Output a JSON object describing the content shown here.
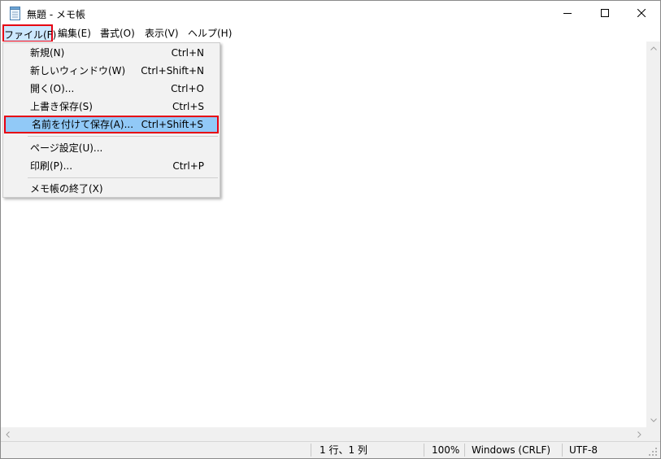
{
  "window": {
    "title": "無題 - メモ帳"
  },
  "menubar": {
    "file": "ファイル(F)",
    "edit": "編集(E)",
    "format": "書式(O)",
    "view": "表示(V)",
    "help": "ヘルプ(H)"
  },
  "file_menu": {
    "items": [
      {
        "label": "新規(N)",
        "shortcut": "Ctrl+N"
      },
      {
        "label": "新しいウィンドウ(W)",
        "shortcut": "Ctrl+Shift+N"
      },
      {
        "label": "開く(O)...",
        "shortcut": "Ctrl+O"
      },
      {
        "label": "上書き保存(S)",
        "shortcut": "Ctrl+S"
      },
      {
        "label": "名前を付けて保存(A)...",
        "shortcut": "Ctrl+Shift+S"
      },
      {
        "label": "ページ設定(U)...",
        "shortcut": ""
      },
      {
        "label": "印刷(P)...",
        "shortcut": "Ctrl+P"
      },
      {
        "label": "メモ帳の終了(X)",
        "shortcut": ""
      }
    ]
  },
  "statusbar": {
    "position": "1 行、1 列",
    "zoom": "100%",
    "line_ending": "Windows (CRLF)",
    "encoding": "UTF-8"
  },
  "colors": {
    "highlight_border": "#e60012",
    "menu_highlight": "#91c9f7"
  }
}
